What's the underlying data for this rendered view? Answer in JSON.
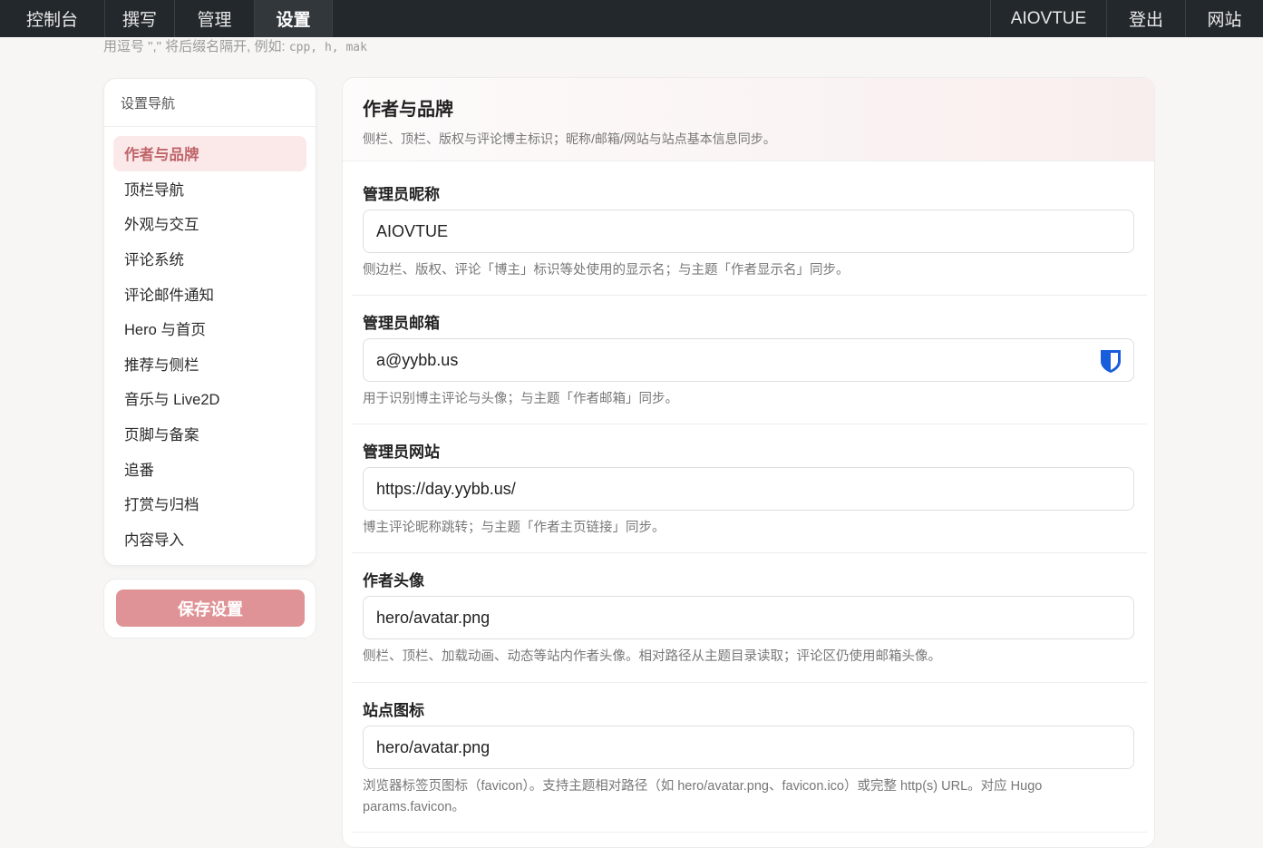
{
  "topbar": {
    "left": [
      "控制台",
      "撰写",
      "管理",
      "设置"
    ],
    "active": "设置",
    "right": [
      "AIOVTUE",
      "登出",
      "网站"
    ]
  },
  "hint_top": {
    "text": "用逗号 \",\" 将后缀名隔开, 例如: ",
    "code": "cpp, h, mak"
  },
  "sidebar": {
    "title": "设置导航",
    "items": [
      "作者与品牌",
      "顶栏导航",
      "外观与交互",
      "评论系统",
      "评论邮件通知",
      "Hero 与首页",
      "推荐与侧栏",
      "音乐与 Live2D",
      "页脚与备案",
      "追番",
      "打赏与归档",
      "内容导入"
    ],
    "active_index": 0
  },
  "save_button": "保存设置",
  "panel": {
    "title": "作者与品牌",
    "subtitle": "侧栏、顶栏、版权与评论博主标识；昵称/邮箱/网站与站点基本信息同步。"
  },
  "fields": [
    {
      "label": "管理员昵称",
      "value": "AIOVTUE",
      "desc": "侧边栏、版权、评论「博主」标识等处使用的显示名；与主题「作者显示名」同步。"
    },
    {
      "label": "管理员邮箱",
      "value": "a@yybb.us",
      "desc": "用于识别博主评论与头像；与主题「作者邮箱」同步。",
      "icon": "bitwarden-shield-icon"
    },
    {
      "label": "管理员网站",
      "value": "https://day.yybb.us/",
      "desc": "博主评论昵称跳转；与主题「作者主页链接」同步。"
    },
    {
      "label": "作者头像",
      "value": "hero/avatar.png",
      "desc": "侧栏、顶栏、加载动画、动态等站内作者头像。相对路径从主题目录读取；评论区仍使用邮箱头像。"
    },
    {
      "label": "站点图标",
      "value": "hero/avatar.png",
      "desc": "浏览器标签页图标（favicon）。支持主题相对路径（如 hero/avatar.png、favicon.ico）或完整 http(s) URL。对应 Hugo params.favicon。"
    }
  ],
  "colors": {
    "topbar_bg": "#23282d",
    "accent": "#c0656a",
    "save_button_bg": "#e09396",
    "shield": "#175ddc"
  }
}
